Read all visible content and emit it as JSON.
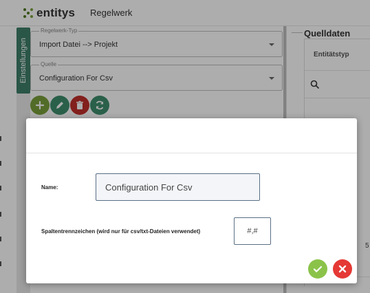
{
  "header": {
    "logo_text": "entitys",
    "title": "Regelwerk"
  },
  "settings": {
    "tab_label": "Einstellungen",
    "rule_type": {
      "legend": "Regelwerk-Typ",
      "value": "Import Datei --> Projekt"
    },
    "source": {
      "legend": "Quelle",
      "value": "Configuration For Csv"
    },
    "buttons": [
      {
        "name": "add",
        "icon": "plus-icon",
        "color": "#7aa03c"
      },
      {
        "name": "edit",
        "icon": "pencil-icon",
        "color": "#3e8e6e"
      },
      {
        "name": "delete",
        "icon": "trash-icon",
        "color": "#c0302b"
      },
      {
        "name": "refresh",
        "icon": "refresh-icon",
        "color": "#3e8e6e"
      }
    ]
  },
  "source_panel": {
    "title": "Quelldaten",
    "column_header": "Entitätstyp",
    "search_icon": "search-icon",
    "partial_value": "5"
  },
  "modal": {
    "name_label": "Name:",
    "name_value": "Configuration For Csv",
    "separator_label": "Spaltentrennzeichen (wird nur für csv/txt-Dateien verwendet)",
    "separator_value": "#,#",
    "confirm": {
      "icon": "check-icon",
      "color": "#8bc34a"
    },
    "cancel": {
      "icon": "close-icon",
      "color": "#e53935"
    }
  }
}
